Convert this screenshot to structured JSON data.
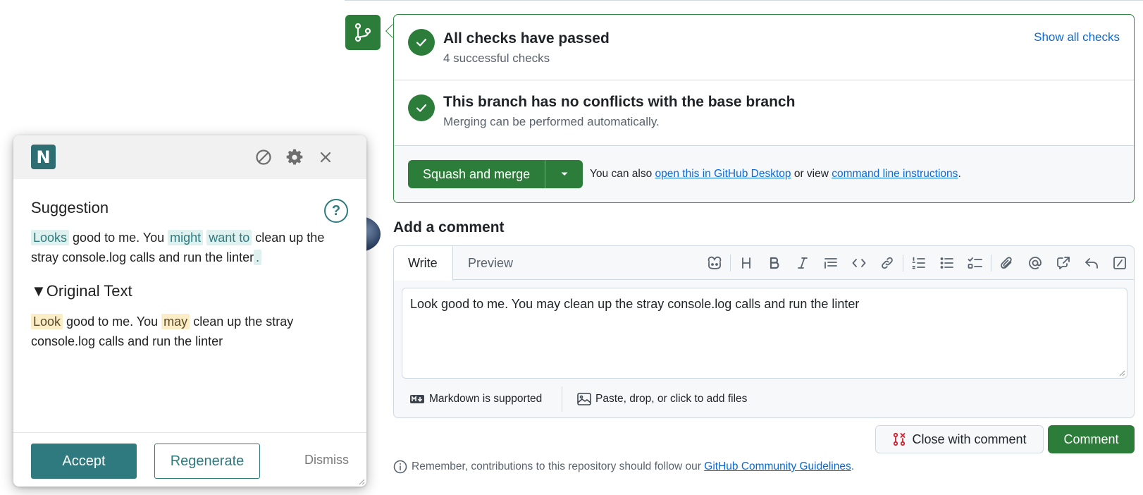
{
  "merge": {
    "checks_title": "All checks have passed",
    "checks_sub": "4 successful checks",
    "show_all": "Show all checks",
    "conflicts_title": "This branch has no conflicts with the base branch",
    "conflicts_sub": "Merging can be performed automatically.",
    "squash_label": "Squash and merge",
    "note_prefix": "You can also ",
    "desktop_link": "open this in GitHub Desktop",
    "note_mid": " or view ",
    "cli_link": "command line instructions",
    "note_suffix": "."
  },
  "comment": {
    "title": "Add a comment",
    "tab_write": "Write",
    "tab_preview": "Preview",
    "text": "Look good to me. You may clean up the stray console.log calls and run the linter",
    "markdown_note": "Markdown is supported",
    "files_note": "Paste, drop, or click to add files",
    "close_label": "Close with comment",
    "comment_label": "Comment",
    "guidelines_prefix": "Remember, contributions to this repository should follow our ",
    "guidelines_link": "GitHub Community Guidelines",
    "guidelines_suffix": "."
  },
  "popup": {
    "logo_letter": "N",
    "suggestion_title": "Suggestion",
    "help_label": "?",
    "suggestion": {
      "w1": "Looks",
      "t1": " good to me. You ",
      "w2": "might",
      "t2": " ",
      "w3": "want to",
      "t3": " clean up the stray console.log calls and run the linter",
      "w4": "."
    },
    "original_title": "▼Original Text",
    "original": {
      "w1": "Look",
      "t1": " good to me. You ",
      "w2": "may",
      "t2": " clean up the stray console.log calls and run the linter"
    },
    "accept_label": "Accept",
    "regenerate_label": "Regenerate",
    "dismiss_label": "Dismiss"
  },
  "colors": {
    "github_green": "#2d7d3a",
    "link_blue": "#0969da",
    "popup_teal": "#2e7a7e",
    "added_bg": "#dff1ef",
    "removed_bg": "#fdedc6"
  },
  "icons": {
    "branch_badge": "git-branch-icon",
    "check": "check-icon",
    "caret": "caret-down-icon",
    "toolbar": [
      "copilot-icon",
      "heading-icon",
      "bold-icon",
      "italic-icon",
      "quote-icon",
      "code-icon",
      "link-icon",
      "ordered-list-icon",
      "unordered-list-icon",
      "task-list-icon",
      "attach-icon",
      "mention-icon",
      "cross-reference-icon",
      "reply-icon",
      "slash-command-icon"
    ],
    "popup_header": [
      "disable-icon",
      "gear-icon",
      "close-icon"
    ]
  }
}
